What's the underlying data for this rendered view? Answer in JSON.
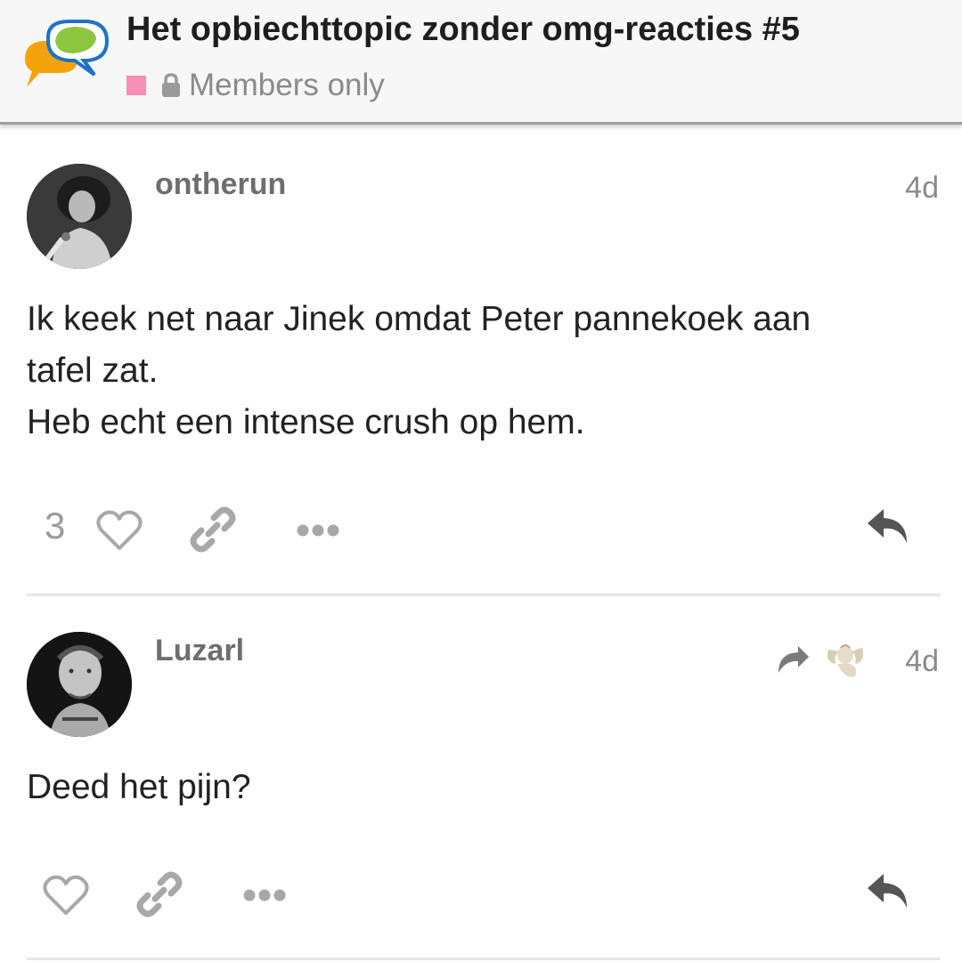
{
  "header": {
    "topic_title": "Het opbiechttopic zonder omg-reacties #5",
    "category_color": "#f58fb4",
    "privacy_label": "Members only",
    "logo_icon": "forum-speech-bubbles-logo",
    "lock_icon": "lock-icon"
  },
  "posts": [
    {
      "username": "ontherun",
      "date": "4d",
      "body_lines": [
        "Ik keek net naar Jinek omdat Peter pannekoek aan",
        "tafel zat.",
        "Heb echt een intense crush op hem."
      ],
      "like_count": "3",
      "actions": [
        "heart-icon",
        "link-icon",
        "more-icon",
        "reply-icon"
      ]
    },
    {
      "username": "Luzarl",
      "date": "4d",
      "body_lines": [
        "Deed het pijn?"
      ],
      "reply_to_icon": "reply-to-arrow-icon",
      "actions": [
        "heart-icon",
        "link-icon",
        "more-icon",
        "reply-icon"
      ]
    }
  ],
  "colors": {
    "accent_pink": "#f58fb4",
    "icon_gray": "#a8a8a8",
    "text_dark": "#222222",
    "meta_gray": "#8a8a8a"
  }
}
